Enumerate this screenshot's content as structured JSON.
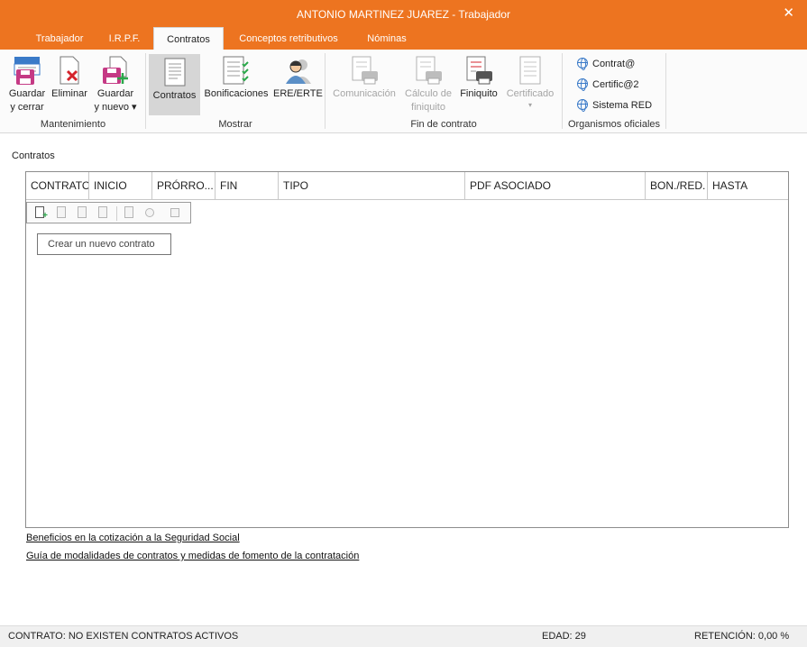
{
  "window": {
    "title": "ANTONIO MARTINEZ JUAREZ - Trabajador"
  },
  "tabs": [
    {
      "label": "Trabajador"
    },
    {
      "label": "I.R.P.F."
    },
    {
      "label": "Contratos"
    },
    {
      "label": "Conceptos retributivos"
    },
    {
      "label": "Nóminas"
    }
  ],
  "ribbon": {
    "mantenimiento": {
      "label": "Mantenimiento",
      "guardar_cerrar": [
        "Guardar",
        "y cerrar"
      ],
      "eliminar": "Eliminar",
      "guardar_nuevo": [
        "Guardar",
        "y nuevo ▾"
      ]
    },
    "mostrar": {
      "label": "Mostrar",
      "contratos": "Contratos",
      "bonificaciones": "Bonificaciones",
      "ere_erte": "ERE/ERTE"
    },
    "fin_contrato": {
      "label": "Fin de contrato",
      "comunicacion": "Comunicación",
      "calculo_finiquito": [
        "Cálculo de",
        "finiquito"
      ],
      "finiquito": "Finiquito",
      "certificado": "Certificado",
      "certificado_arrow": "▾"
    },
    "organismos": {
      "label": "Organismos oficiales",
      "contrata": "Contrat@",
      "certifica2": "Certific@2",
      "sistema_red": "Sistema RED"
    }
  },
  "section_title": "Contratos",
  "grid": {
    "columns": [
      "CONTRATO",
      "INICIO",
      "PRÓRRO...",
      "FIN",
      "TIPO",
      "PDF ASOCIADO",
      "BON./RED.",
      "HASTA"
    ],
    "rows": [],
    "tooltip": "Crear un nuevo contrato"
  },
  "links": {
    "beneficios": "Beneficios en la cotización a la Seguridad Social",
    "guia": "Guía de modalidades de contratos y medidas de fomento de la contratación"
  },
  "status": {
    "contrato": "CONTRATO: NO EXISTEN CONTRATOS ACTIVOS",
    "edad": "EDAD: 29",
    "retencion": "RETENCIÓN: 0,00 %"
  },
  "colors": {
    "accent": "#ed7420",
    "selected": "#d6d6d6",
    "link": "#111111"
  },
  "icons": [
    "save-close-icon",
    "delete-icon",
    "save-new-icon",
    "contracts-icon",
    "bonus-icon",
    "ere-erte-icon",
    "communication-icon",
    "calc-settlement-icon",
    "settlement-icon",
    "certificate-icon",
    "globe-icon",
    "close-icon"
  ]
}
